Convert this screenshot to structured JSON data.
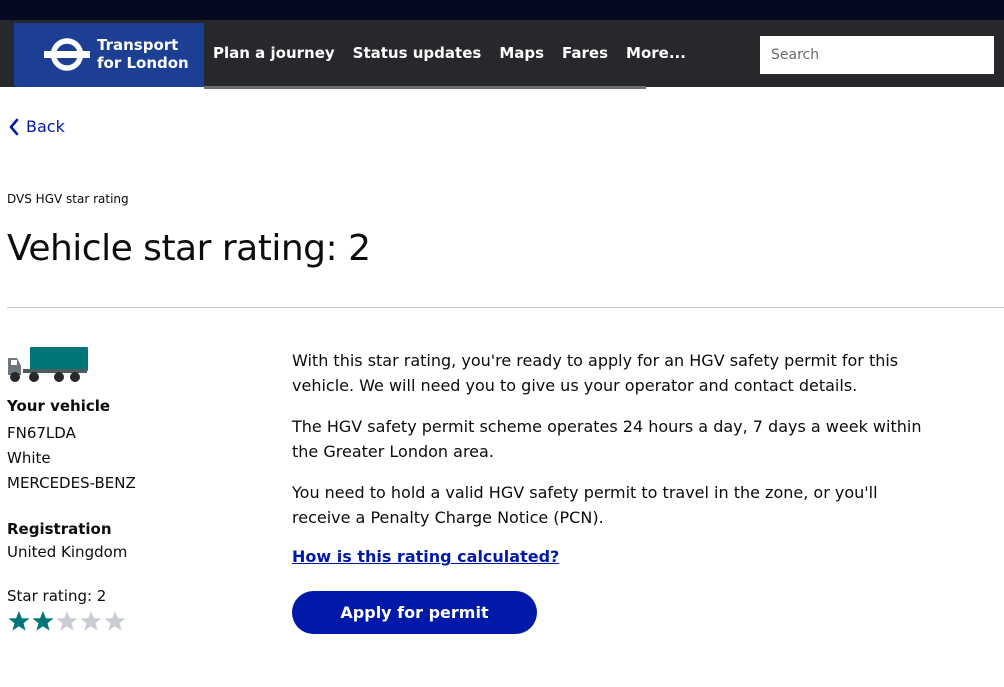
{
  "header": {
    "logo_line1": "Transport",
    "logo_line2": "for London",
    "nav": [
      "Plan a journey",
      "Status updates",
      "Maps",
      "Fares",
      "More..."
    ],
    "search_placeholder": "Search"
  },
  "back_label": "Back",
  "caption": "DVS HGV star rating",
  "title": "Vehicle star rating: 2",
  "vehicle": {
    "heading": "Your vehicle",
    "registration_plate": "FN67LDA",
    "colour": "White",
    "make": "MERCEDES-BENZ"
  },
  "registration": {
    "heading": "Registration",
    "value": "United Kingdom"
  },
  "star_rating": {
    "label": "Star rating: 2",
    "filled": 2,
    "total": 5,
    "filled_color": "#00757a",
    "empty_color": "#c8cdd5"
  },
  "content": {
    "para1": "With this star rating, you're ready to apply for an HGV safety permit for this vehicle. We will need you to give us your operator and contact details.",
    "para2": "The HGV safety permit scheme operates 24 hours a day, 7 days a week within the Greater London area.",
    "para3": "You need to hold a valid HGV safety permit to travel in the zone, or you'll receive a Penalty Charge Notice (PCN).",
    "calc_link": "How is this rating calculated?",
    "apply_button": "Apply for permit"
  },
  "colors": {
    "brand_blue": "#0019a8",
    "logo_blue": "#1c3f94",
    "nav_bg": "#26282b"
  }
}
